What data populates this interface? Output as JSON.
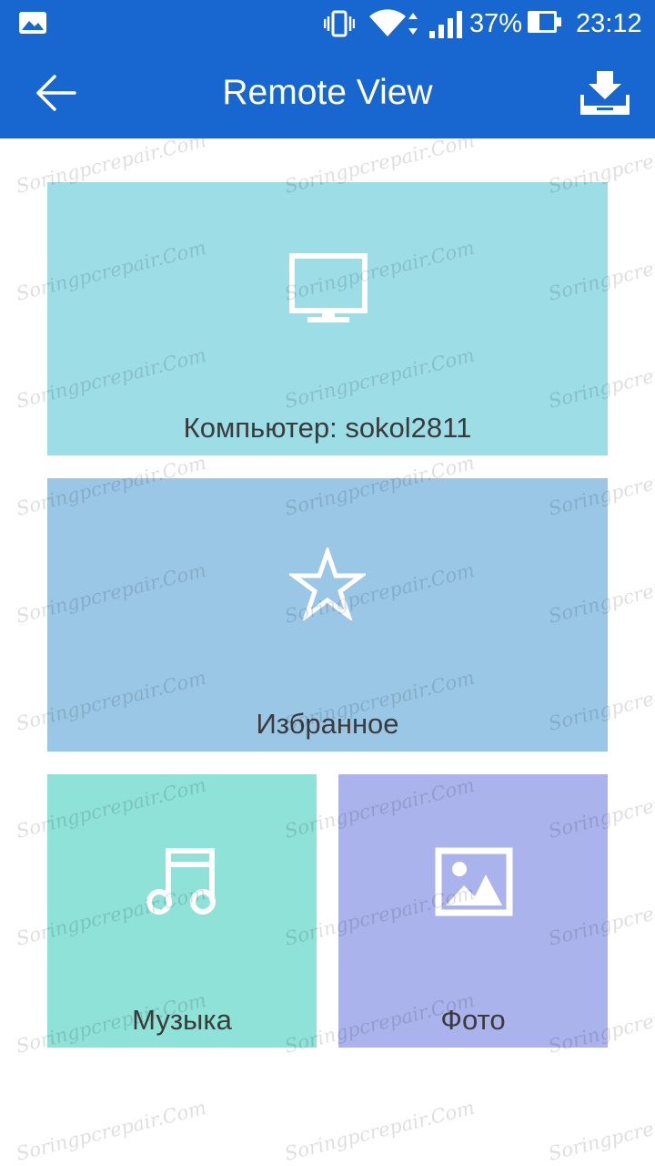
{
  "status_bar": {
    "battery_percent": "37%",
    "time": "23:12",
    "icons": [
      "image-icon",
      "vibrate-icon",
      "wifi-icon",
      "signal-icon",
      "battery-icon"
    ],
    "battery_level": 0.37
  },
  "app_bar": {
    "title": "Remote View",
    "back_icon": "arrow-left-icon",
    "action_icon": "download-tray-icon"
  },
  "tiles": {
    "computer": {
      "label": "Компьютер: sokol2811",
      "icon": "monitor-icon",
      "color": "#9cdde6"
    },
    "favorites": {
      "label": "Избранное",
      "icon": "star-outline-icon",
      "color": "#9ac7e6"
    },
    "music": {
      "label": "Музыка",
      "icon": "music-note-icon",
      "color": "#8ee2d8"
    },
    "photo": {
      "label": "Фото",
      "icon": "image-icon",
      "color": "#aab3ec"
    }
  },
  "watermark": {
    "text": "Soringpcrepair.Com"
  },
  "colors": {
    "primary": "#1866cf",
    "label_text": "#3b3b3b"
  }
}
